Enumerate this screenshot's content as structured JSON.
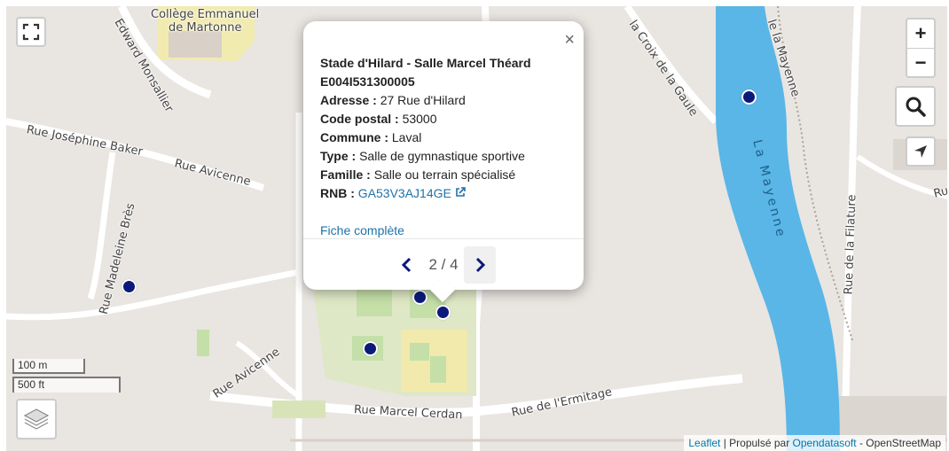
{
  "map": {
    "labels": [
      {
        "name": "street-label-college",
        "text": "Collège Emmanuel"
      },
      {
        "name": "street-label-college-2",
        "text": "de Martonne"
      },
      {
        "name": "street-label-edward",
        "text": "Edward Monsallier"
      },
      {
        "name": "street-label-josephine",
        "text": "Rue Joséphine Baker"
      },
      {
        "name": "street-label-avicenne",
        "text": "Rue Avicenne"
      },
      {
        "name": "street-label-madeleine",
        "text": "Rue Madeleine Brès"
      },
      {
        "name": "street-label-avicenne-2",
        "text": "Rue Avicenne"
      },
      {
        "name": "street-label-cerdan",
        "text": "Rue Marcel Cerdan"
      },
      {
        "name": "street-label-ermitage",
        "text": "Rue de l'Ermitage"
      },
      {
        "name": "street-label-croix",
        "text": "la Croix de la Gaule"
      },
      {
        "name": "street-label-mayenne-quai",
        "text": "le la Mayenne"
      },
      {
        "name": "street-label-filature",
        "text": "Rue de la Filature"
      },
      {
        "name": "street-label-ru",
        "text": "Ru"
      },
      {
        "name": "river-label",
        "text": "La Mayenne"
      }
    ]
  },
  "popup": {
    "title": "Stade d'Hilard - Salle Marcel Théard",
    "id": "E004I531300005",
    "fields": [
      {
        "label": "Adresse :",
        "value": "27 Rue d'Hilard"
      },
      {
        "label": "Code postal :",
        "value": "53000"
      },
      {
        "label": "Commune :",
        "value": "Laval"
      },
      {
        "label": "Type :",
        "value": "Salle de gymnastique sportive"
      },
      {
        "label": "Famille :",
        "value": "Salle ou terrain spécialisé"
      }
    ],
    "rnb_label": "RNB :",
    "rnb_value": "GA53V3AJ14GE",
    "link_full": "Fiche complète",
    "pager": "2 / 4",
    "close": "×"
  },
  "controls": {
    "zoom_in": "+",
    "zoom_out": "−"
  },
  "scale": {
    "metric": "100 m",
    "imperial": "500 ft"
  },
  "attribution": {
    "leaflet": "Leaflet",
    "sep1": " | Propulsé par ",
    "ods": "Opendatasoft",
    "sep2": " - OpenStreetMap"
  },
  "colors": {
    "marker": "#0b1a7a",
    "river": "#5ab6e6",
    "link": "#1f72a8"
  }
}
